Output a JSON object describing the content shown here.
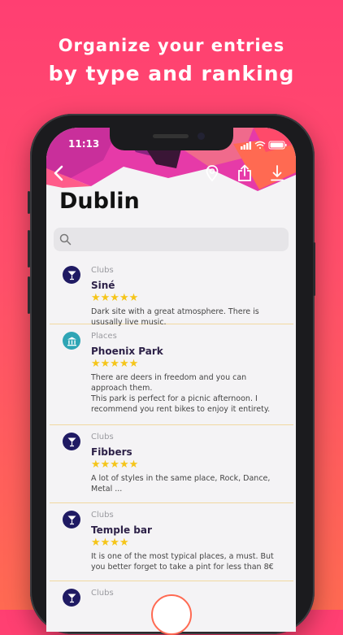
{
  "headline": {
    "line1": "Organize your entries",
    "line2": "by type and ranking"
  },
  "status": {
    "time": "11:13"
  },
  "page": {
    "title": "Dublin"
  },
  "search": {
    "placeholder": "",
    "value": ""
  },
  "colors": {
    "club_badge": "#1f1a63",
    "place_badge": "#2fa5b5",
    "star": "#f5c51a",
    "divider": "#f1d8a0"
  },
  "entries": [
    {
      "category": "Clubs",
      "icon": "cocktail-icon",
      "name": "Siné",
      "stars": "★★★★★",
      "rating": 5,
      "description": "Dark site with a great atmosphere. There is ususally live music."
    },
    {
      "category": "Places",
      "icon": "monument-icon",
      "name": "Phoenix Park",
      "stars": "★★★★★",
      "rating": 5,
      "description": "There are deers in freedom and you can approach them.\nThis park is perfect for a picnic afternoon. I recommend you rent bikes to enjoy it entirety."
    },
    {
      "category": "Clubs",
      "icon": "cocktail-icon",
      "name": "Fibbers",
      "stars": "★★★★★",
      "rating": 5,
      "description": "A lot of styles in the same place, Rock, Dance, Metal ..."
    },
    {
      "category": "Clubs",
      "icon": "cocktail-icon",
      "name": "Temple bar",
      "stars": "★★★★",
      "rating": 4,
      "description": "It is one of the most typical places, a must. But you better forget to take a pint for less than 8€"
    },
    {
      "category": "Clubs",
      "icon": "cocktail-icon",
      "name": "",
      "stars": "",
      "description": ""
    }
  ]
}
